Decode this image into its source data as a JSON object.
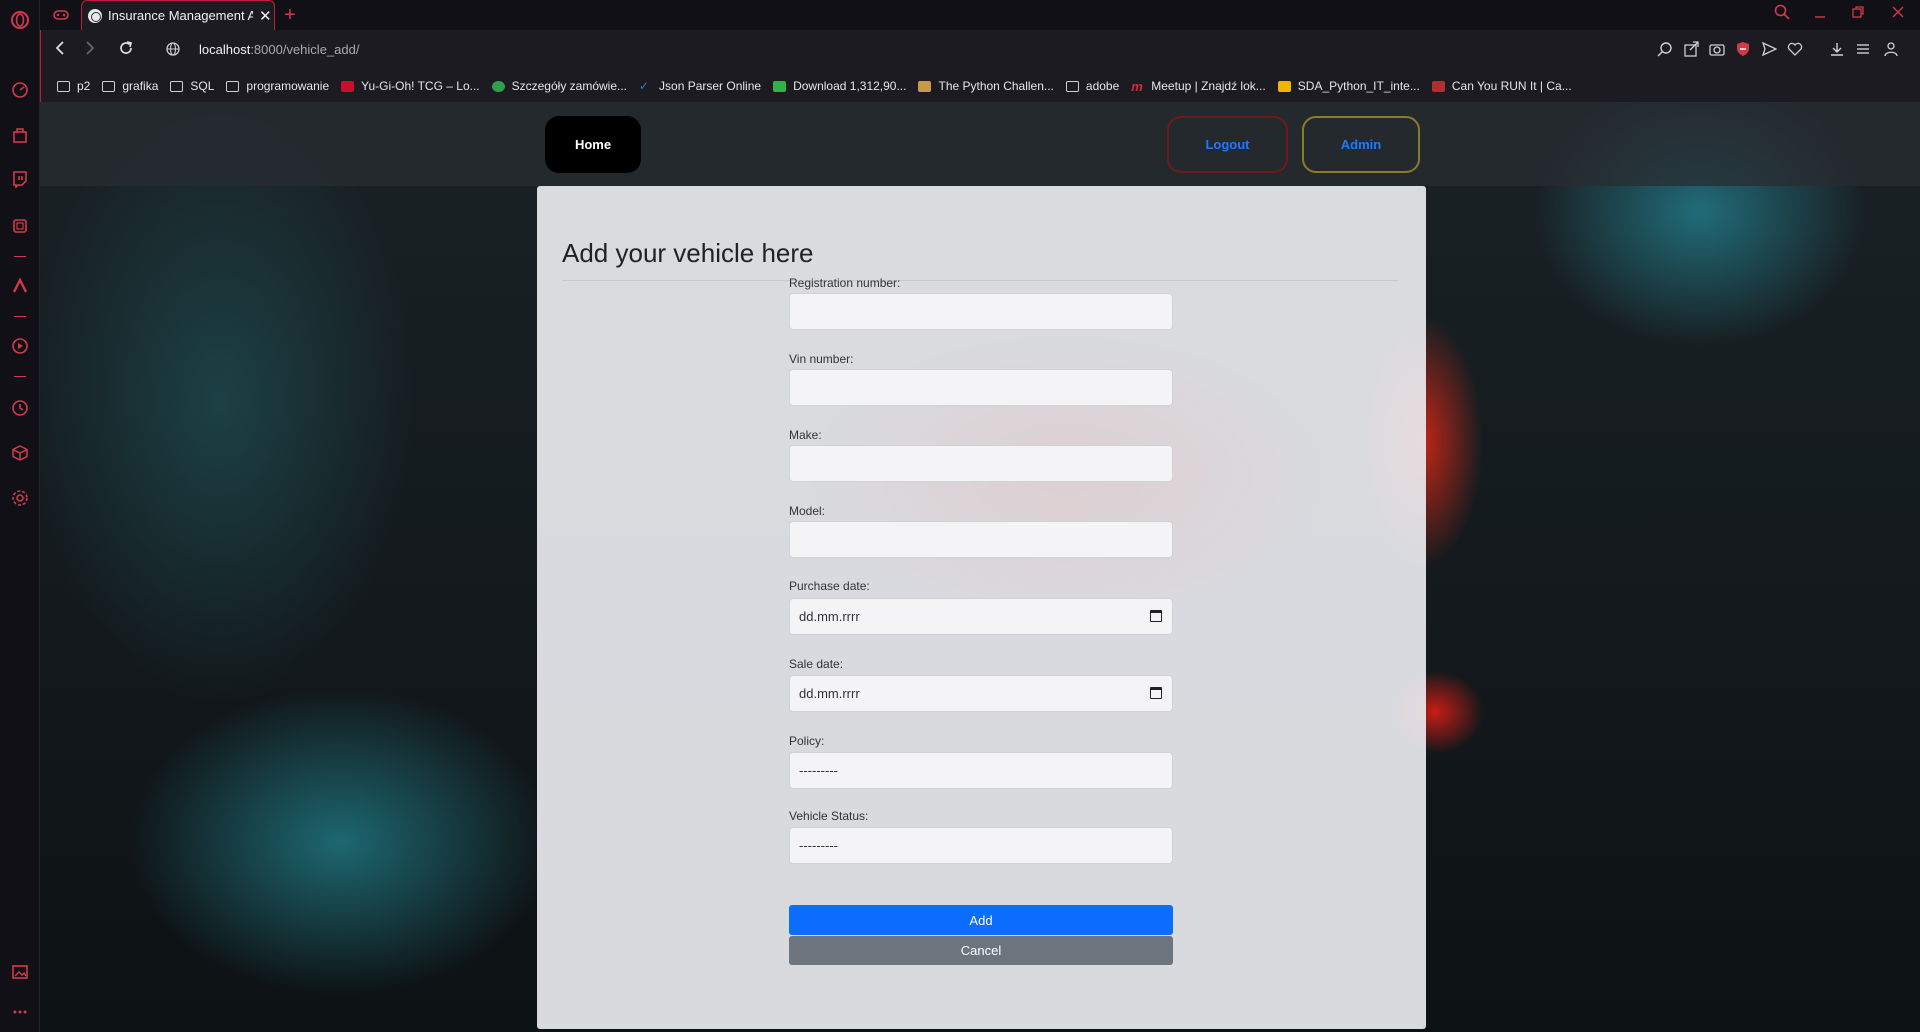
{
  "browser": {
    "tab_title": "Insurance Management Ap",
    "url_host": "localhost",
    "url_path": ":8000/vehicle_add/",
    "bookmarks": [
      {
        "label": "p2",
        "type": "folder"
      },
      {
        "label": "grafika",
        "type": "folder"
      },
      {
        "label": "SQL",
        "type": "folder"
      },
      {
        "label": "programowanie",
        "type": "folder"
      },
      {
        "label": "Yu-Gi-Oh! TCG – Lo...",
        "type": "site",
        "color": "#c8102e"
      },
      {
        "label": "Szczegóły zamówie...",
        "type": "site",
        "color": "#2e9e4f"
      },
      {
        "label": "Json Parser Online",
        "type": "site",
        "color": "#3a6fd8"
      },
      {
        "label": "Download 1,312,90...",
        "type": "site",
        "color": "#2fb344"
      },
      {
        "label": "The Python Challen...",
        "type": "site",
        "color": "#c79a4a"
      },
      {
        "label": "adobe",
        "type": "folder"
      },
      {
        "label": "Meetup | Znajdź lok...",
        "type": "site",
        "color": "#e0233c"
      },
      {
        "label": "SDA_Python_IT_inte...",
        "type": "site",
        "color": "#f2b400"
      },
      {
        "label": "Can You RUN It | Ca...",
        "type": "site",
        "color": "#b03030"
      }
    ]
  },
  "nav": {
    "home": "Home",
    "logout": "Logout",
    "admin": "Admin"
  },
  "form": {
    "title": "Add your vehicle here",
    "fields": [
      {
        "label": "Registration number:",
        "value": ""
      },
      {
        "label": "Vin number:",
        "value": ""
      },
      {
        "label": "Make:",
        "value": ""
      },
      {
        "label": "Model:",
        "value": ""
      },
      {
        "label": "Purchase date:",
        "value": "dd.mm.rrrr"
      },
      {
        "label": "Sale date:",
        "value": "dd.mm.rrrr"
      },
      {
        "label": "Policy:",
        "value": "---------"
      },
      {
        "label": "Vehicle Status:",
        "value": "---------"
      }
    ],
    "add_label": "Add",
    "cancel_label": "Cancel"
  },
  "colors": {
    "accent": "#c01e36",
    "primary_button": "#0d6efd",
    "secondary_button": "#6c757d"
  }
}
